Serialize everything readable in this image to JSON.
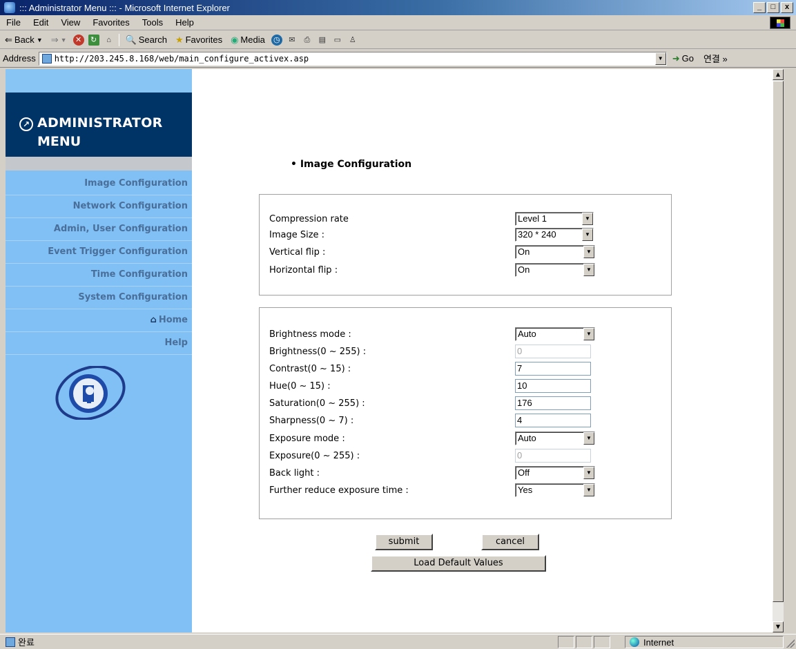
{
  "window": {
    "title": "::: Administrator Menu ::: - Microsoft Internet Explorer",
    "min_label": "_",
    "max_label": "□",
    "close_label": "x"
  },
  "menu": [
    "File",
    "Edit",
    "View",
    "Favorites",
    "Tools",
    "Help"
  ],
  "toolbar": {
    "back": "Back",
    "search": "Search",
    "favorites": "Favorites",
    "media": "Media"
  },
  "address": {
    "label": "Address",
    "url": "http://203.245.8.168/web/main_configure_activex.asp",
    "go": "Go",
    "links": "연결 »"
  },
  "sidebar": {
    "title_line1": "ADMINISTRATOR",
    "title_line2": "MENU",
    "items": [
      {
        "label": "Image Configuration"
      },
      {
        "label": "Network Configuration"
      },
      {
        "label": "Admin, User Configuration"
      },
      {
        "label": "Event Trigger Configuration"
      },
      {
        "label": "Time Configuration"
      },
      {
        "label": "System Configuration"
      },
      {
        "label": "Home"
      },
      {
        "label": "Help"
      }
    ]
  },
  "content": {
    "section_title": "Image Configuration",
    "group_a": [
      {
        "label": "Compression rate",
        "value": "Level 1"
      },
      {
        "label": "Image Size :",
        "value": "320 * 240"
      },
      {
        "label": "Vertical flip :",
        "value": "On"
      },
      {
        "label": "Horizontal flip :",
        "value": "On"
      }
    ],
    "group_b": {
      "brightness_mode": {
        "label": "Brightness mode :",
        "value": "Auto"
      },
      "brightness": {
        "label": "Brightness(0 ~ 255) :",
        "value": "0"
      },
      "contrast": {
        "label": "Contrast(0 ~ 15) :",
        "value": "7"
      },
      "hue": {
        "label": "Hue(0 ~ 15) :",
        "value": "10"
      },
      "saturation": {
        "label": "Saturation(0 ~ 255) :",
        "value": "176"
      },
      "sharpness": {
        "label": "Sharpness(0 ~ 7) :",
        "value": "4"
      },
      "exposure_mode": {
        "label": "Exposure mode :",
        "value": "Auto"
      },
      "exposure": {
        "label": "Exposure(0 ~ 255) :",
        "value": "0"
      },
      "back_light": {
        "label": "Back light :",
        "value": "Off"
      },
      "further_reduce": {
        "label": "Further reduce exposure time :",
        "value": "Yes"
      }
    },
    "buttons": {
      "submit": "submit",
      "cancel": "cancel",
      "load_default": "Load Default Values"
    }
  },
  "status": {
    "text": "완료",
    "zone": "Internet"
  }
}
